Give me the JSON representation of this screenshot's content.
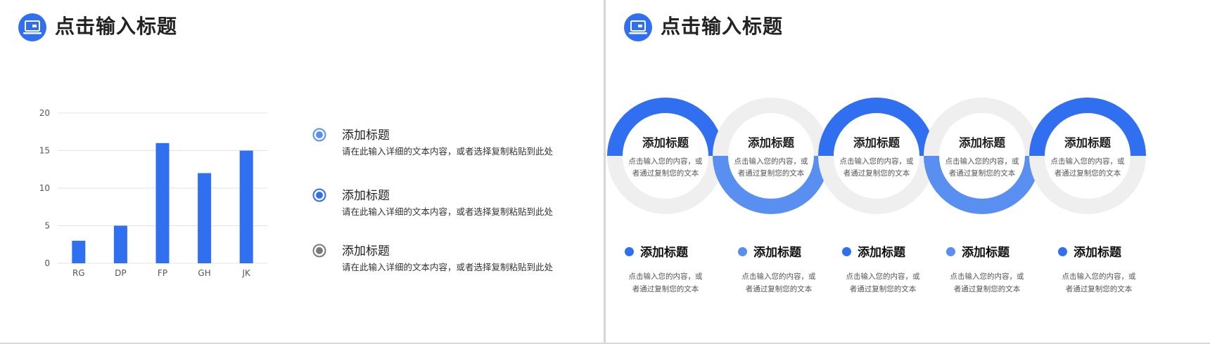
{
  "slide_left": {
    "header": {
      "title": "点击输入标题",
      "icon": "laptop-icon"
    },
    "chart_data": {
      "type": "bar",
      "categories": [
        "RG",
        "DP",
        "FP",
        "GH",
        "JK"
      ],
      "values": [
        3,
        5,
        16,
        12,
        15
      ],
      "ylim": [
        0,
        20
      ],
      "yticks": [
        0,
        5,
        10,
        15,
        20
      ],
      "grid": true,
      "bar_color": "#2f6ff0",
      "title": "",
      "xlabel": "",
      "ylabel": ""
    },
    "legend": [
      {
        "title": "添加标题",
        "text": "请在此输入详细的文本内容，或者选择复制粘贴到此处",
        "color": "#5a8ff2",
        "icon": "radio-light-icon"
      },
      {
        "title": "添加标题",
        "text": "请在此输入详细的文本内容，或者选择复制粘贴到此处",
        "color": "#2f6ff0",
        "icon": "radio-blue-icon"
      },
      {
        "title": "添加标题",
        "text": "请在此输入详细的文本内容，或者选择复制粘贴到此处",
        "color": "#7a7a7a",
        "icon": "radio-gray-icon"
      }
    ]
  },
  "slide_right": {
    "header": {
      "title": "点击输入标题",
      "icon": "laptop-icon"
    },
    "colors": {
      "dark": "#2f6ff0",
      "light": "#5a8ff2",
      "gray": "#efefef"
    },
    "rings": [
      {
        "title": "添加标题",
        "text_line1": "点击输入您的内容，或",
        "text_line2": "者通过复制您的文本"
      },
      {
        "title": "添加标题",
        "text_line1": "点击输入您的内容，或",
        "text_line2": "者通过复制您的文本"
      },
      {
        "title": "添加标题",
        "text_line1": "点击输入您的内容，或",
        "text_line2": "者通过复制您的文本"
      },
      {
        "title": "添加标题",
        "text_line1": "点击输入您的内容，或",
        "text_line2": "者通过复制您的文本"
      },
      {
        "title": "添加标题",
        "text_line1": "点击输入您的内容，或",
        "text_line2": "者通过复制您的文本"
      }
    ],
    "items": [
      {
        "title": "添加标题",
        "text_line1": "点击输入您的内容，或",
        "text_line2": "者通过复制您的文本",
        "color": "#2f6ff0"
      },
      {
        "title": "添加标题",
        "text_line1": "点击输入您的内容，或",
        "text_line2": "者通过复制您的文本",
        "color": "#5a8ff2"
      },
      {
        "title": "添加标题",
        "text_line1": "点击输入您的内容，或",
        "text_line2": "者通过复制您的文本",
        "color": "#2f6ff0"
      },
      {
        "title": "添加标题",
        "text_line1": "点击输入您的内容，或",
        "text_line2": "者通过复制您的文本",
        "color": "#5a8ff2"
      },
      {
        "title": "添加标题",
        "text_line1": "点击输入您的内容，或",
        "text_line2": "者通过复制您的文本",
        "color": "#2f6ff0"
      }
    ]
  }
}
